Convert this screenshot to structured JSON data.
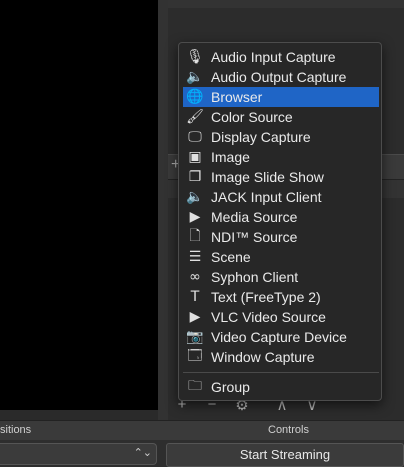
{
  "menu": {
    "items": [
      {
        "label": "Audio Input Capture",
        "icon": "microphone-icon",
        "glyph": "🎙"
      },
      {
        "label": "Audio Output Capture",
        "icon": "speaker-icon",
        "glyph": "🔈"
      },
      {
        "label": "Browser",
        "icon": "globe-icon",
        "glyph": "🌐"
      },
      {
        "label": "Color Source",
        "icon": "paintbrush-icon",
        "glyph": "🖌"
      },
      {
        "label": "Display Capture",
        "icon": "monitor-icon",
        "glyph": "🖵"
      },
      {
        "label": "Image",
        "icon": "image-icon",
        "glyph": "▣"
      },
      {
        "label": "Image Slide Show",
        "icon": "slideshow-icon",
        "glyph": "❐"
      },
      {
        "label": "JACK Input Client",
        "icon": "speaker-icon",
        "glyph": "🔈"
      },
      {
        "label": "Media Source",
        "icon": "play-icon",
        "glyph": "▶"
      },
      {
        "label": "NDI™ Source",
        "icon": "document-icon",
        "glyph": "🗋"
      },
      {
        "label": "Scene",
        "icon": "list-icon",
        "glyph": "☰"
      },
      {
        "label": "Syphon Client",
        "icon": "gamepad-icon",
        "glyph": "∞"
      },
      {
        "label": "Text (FreeType 2)",
        "icon": "text-icon",
        "glyph": "T"
      },
      {
        "label": "VLC Video Source",
        "icon": "play-icon",
        "glyph": "▶"
      },
      {
        "label": "Video Capture Device",
        "icon": "camera-icon",
        "glyph": "📷"
      },
      {
        "label": "Window Capture",
        "icon": "window-icon",
        "glyph": "🗔"
      }
    ],
    "group": {
      "label": "Group",
      "icon": "folder-icon",
      "glyph": "🗀"
    },
    "selected_index": 2,
    "selected_color": "#1f65c6"
  },
  "panels": {
    "transitions_label": "sitions",
    "controls_label": "Controls"
  },
  "controls": {
    "start_streaming": "Start Streaming"
  },
  "toolbar": {
    "add": "+",
    "remove": "−",
    "settings": "⚙",
    "up": "∧",
    "down": "∨"
  }
}
